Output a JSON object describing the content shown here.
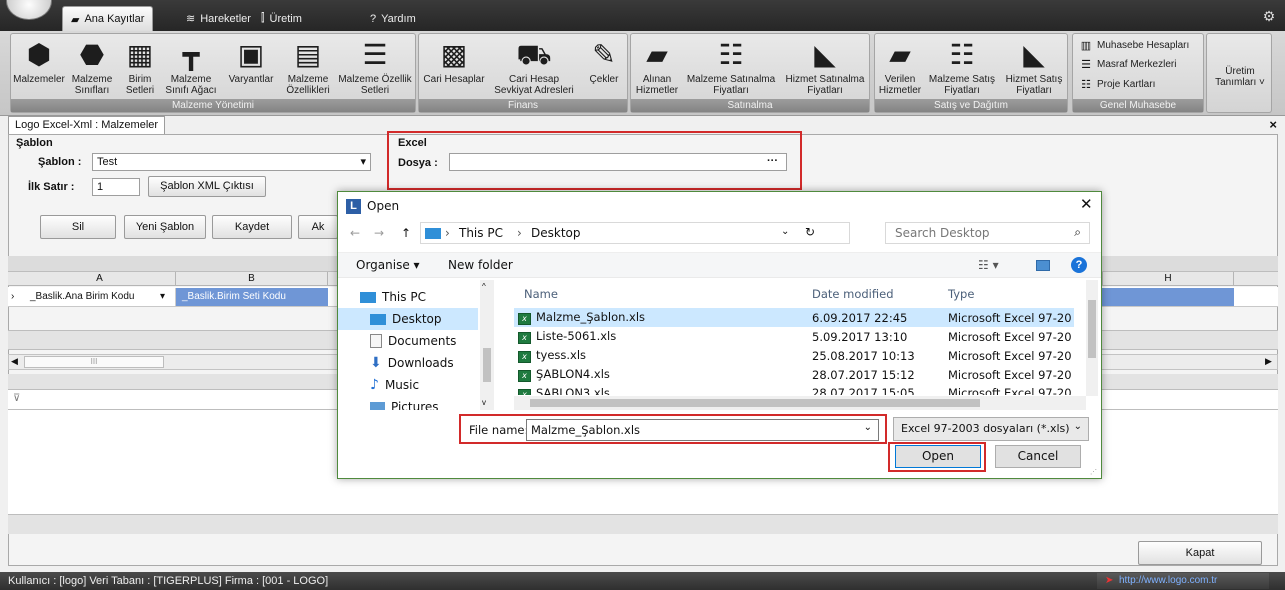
{
  "ribbon_tabs": [
    "Ana Kayıtlar",
    "Hareketler",
    "Üretim",
    "Yardım"
  ],
  "ribbon": {
    "malzeme": {
      "label": "Malzeme Yönetimi",
      "buttons": [
        {
          "icon": "cube-icon",
          "l1": "Malzemeler",
          "l2": ""
        },
        {
          "icon": "cube-classes-icon",
          "l1": "Malzeme",
          "l2": "Sınıfları"
        },
        {
          "icon": "grid-icon",
          "l1": "Birim",
          "l2": "Setleri"
        },
        {
          "icon": "hierarchy-icon",
          "l1": "Malzeme",
          "l2": "Sınıfı Ağacı"
        },
        {
          "icon": "variant-icon",
          "l1": "Varyantlar",
          "l2": ""
        },
        {
          "icon": "edit-list-icon",
          "l1": "Malzeme",
          "l2": "Özellikleri"
        },
        {
          "icon": "database-icon",
          "l1": "Malzeme Özellik",
          "l2": "Setleri"
        }
      ]
    },
    "finans": {
      "label": "Finans",
      "buttons": [
        {
          "icon": "id-card-icon",
          "l1": "Cari Hesaplar",
          "l2": ""
        },
        {
          "icon": "truck-icon",
          "l1": "Cari Hesap",
          "l2": "Sevkiyat Adresleri"
        },
        {
          "icon": "check-write-icon",
          "l1": "Çekler",
          "l2": ""
        }
      ]
    },
    "satinalma": {
      "label": "Satınalma",
      "buttons": [
        {
          "icon": "folder-in-icon",
          "l1": "Alınan",
          "l2": "Hizmetler"
        },
        {
          "icon": "list-icon",
          "l1": "Malzeme Satınalma",
          "l2": "Fiyatları"
        },
        {
          "icon": "tag-icon",
          "l1": "Hizmet Satınalma",
          "l2": "Fiyatları"
        }
      ]
    },
    "satis": {
      "label": "Satış ve Dağıtım",
      "buttons": [
        {
          "icon": "folder-out-icon",
          "l1": "Verilen",
          "l2": "Hizmetler"
        },
        {
          "icon": "list-icon",
          "l1": "Malzeme Satış",
          "l2": "Fiyatları"
        },
        {
          "icon": "tag-icon",
          "l1": "Hizmet Satış",
          "l2": "Fiyatları"
        }
      ]
    },
    "genel": {
      "label": "Genel Muhasebe",
      "items": [
        "Muhasebe Hesapları",
        "Masraf Merkezleri",
        "Proje Kartları"
      ]
    },
    "uretim": {
      "l1": "Üretim",
      "l2": "Tanımları ˅"
    }
  },
  "document_tab": "Logo Excel-Xml : Malzemeler",
  "sablon": {
    "group_title": "Şablon",
    "sablon_label": "Şablon :",
    "sablon_value": "Test",
    "ilk_satir_label": "İlk Satır :",
    "ilk_satir_value": "1",
    "xml_button": "Şablon XML Çıktısı",
    "buttons": [
      "Sil",
      "Yeni Şablon",
      "Kaydet",
      "Ak"
    ]
  },
  "excel": {
    "group_title": "Excel",
    "dosya_label": "Dosya :",
    "dosya_value": "",
    "browse": "···"
  },
  "grid": {
    "columns": [
      "A",
      "B",
      "H"
    ],
    "row_cells": [
      "_Baslik.Ana Birim Kodu",
      "_Baslik.Birim Seti Kodu"
    ],
    "scroll_mark": "III"
  },
  "close_button": "Kapat",
  "status": {
    "text": "Kullanıcı : [logo]  Veri Tabanı : [TIGERPLUS]  Firma : [001 - LOGO]",
    "url": "http://www.logo.com.tr"
  },
  "dialog": {
    "title": "Open",
    "path": [
      "This PC",
      "Desktop"
    ],
    "search_placeholder": "Search Desktop",
    "organise": "Organise ▾",
    "new_folder": "New folder",
    "nav_items": [
      "This PC",
      "Desktop",
      "Documents",
      "Downloads",
      "Music",
      "Pictures"
    ],
    "columns": [
      "Name",
      "Date modified",
      "Type"
    ],
    "files": [
      {
        "name": "Malzme_Şablon.xls",
        "date": "6.09.2017 22:45",
        "type": "Microsoft Excel 97-20..."
      },
      {
        "name": "Liste-5061.xls",
        "date": "5.09.2017 13:10",
        "type": "Microsoft Excel 97-20..."
      },
      {
        "name": "tyess.xls",
        "date": "25.08.2017 10:13",
        "type": "Microsoft Excel 97-20..."
      },
      {
        "name": "ŞABLON4.xls",
        "date": "28.07.2017 15:12",
        "type": "Microsoft Excel 97-20..."
      },
      {
        "name": "ŞABLON3.xls",
        "date": "28.07.2017 15:05",
        "type": "Microsoft Excel 97-20..."
      }
    ],
    "filename_label": "File name:",
    "filename_value": "Malzme_Şablon.xls",
    "filetype": "Excel 97-2003 dosyaları (*.xls)",
    "open_button": "Open",
    "cancel_button": "Cancel"
  },
  "colors": {
    "highlight_red": "#d22a2a",
    "selected_blue": "#cce8ff",
    "grid_select": "#6f96d6"
  }
}
